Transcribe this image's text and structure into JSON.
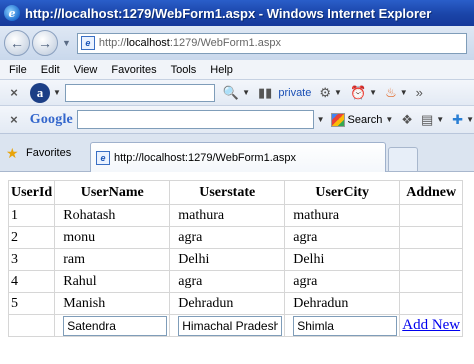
{
  "window": {
    "title": "http://localhost:1279/WebForm1.aspx - Windows Internet Explorer"
  },
  "address": {
    "prefix": "http://",
    "host": "localhost",
    "path": ":1279/WebForm1.aspx"
  },
  "menu": [
    "File",
    "Edit",
    "View",
    "Favorites",
    "Tools",
    "Help"
  ],
  "toolbar": {
    "private_label": "private"
  },
  "google_bar": {
    "logo": "Google",
    "search_label": "Search"
  },
  "favorites": {
    "label": "Favorites"
  },
  "tab": {
    "label": "http://localhost:1279/WebForm1.aspx"
  },
  "grid": {
    "headers": [
      "UserId",
      "UserName",
      "Userstate",
      "UserCity",
      "Addnew"
    ],
    "rows": [
      [
        "1",
        "Rohatash",
        "mathura",
        "mathura"
      ],
      [
        "2",
        "monu",
        "agra",
        "agra"
      ],
      [
        "3",
        "ram",
        "Delhi",
        "Delhi"
      ],
      [
        "4",
        "Rahul",
        "agra",
        "agra"
      ],
      [
        "5",
        "Manish",
        "Dehradun",
        "Dehradun"
      ]
    ],
    "new_row": {
      "name_value": "Satendra",
      "state_value": "Himachal Pradesh",
      "city_value": "Shimla",
      "add_link": "Add New"
    }
  },
  "colors": {
    "title_bar": "#1a44a8",
    "link": "#0000ee",
    "chrome": "#dde6f2"
  }
}
